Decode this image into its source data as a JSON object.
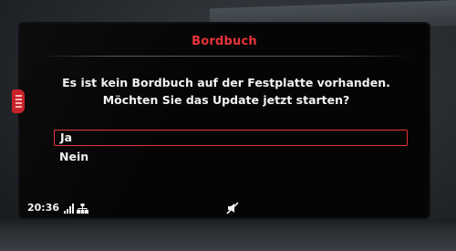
{
  "dialog": {
    "title": "Bordbuch",
    "message": "Es ist kein Bordbuch auf der Festplatte vorhanden. Möchten Sie das Update jetzt starten?",
    "options": [
      {
        "label": "Ja",
        "selected": true
      },
      {
        "label": "Nein",
        "selected": false
      }
    ]
  },
  "status_bar": {
    "time": "20:36",
    "icons": [
      "signal-strength-icon",
      "network-icon",
      "speaker-muted-icon"
    ]
  },
  "colors": {
    "accent": "#e8343a",
    "text": "#f2f2f2",
    "background": "#050505"
  }
}
